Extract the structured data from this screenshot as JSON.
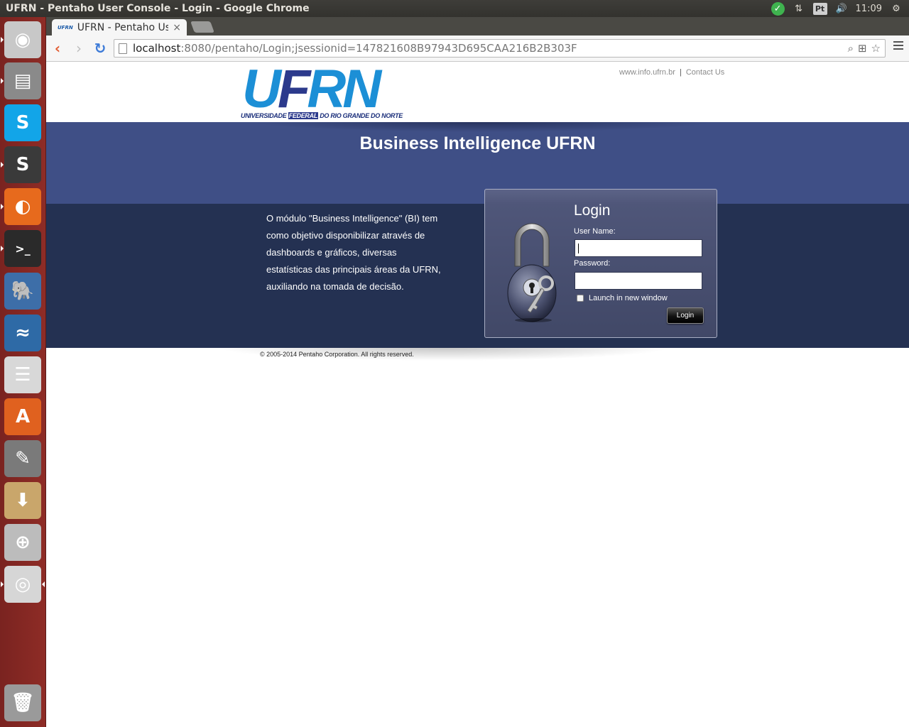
{
  "window": {
    "title": "UFRN - Pentaho User Console - Login - Google Chrome"
  },
  "tray": {
    "keyboard_layout": "Pt",
    "time": "11:09"
  },
  "launcher": {
    "items": [
      {
        "name": "ubuntu-dash",
        "glyph": "◉",
        "color": "#c8c8c8"
      },
      {
        "name": "files",
        "glyph": "▤",
        "color": "#8a8a8a"
      },
      {
        "name": "skype",
        "glyph": "S",
        "color": "#12a5e8"
      },
      {
        "name": "sublime-text",
        "glyph": "S",
        "color": "#3a3a3a"
      },
      {
        "name": "firefox",
        "glyph": "◐",
        "color": "#e76a1d"
      },
      {
        "name": "terminal",
        "glyph": ">_",
        "color": "#2a2a2a"
      },
      {
        "name": "pgadmin",
        "glyph": "🐘",
        "color": "#3d6ea8"
      },
      {
        "name": "mysql-workbench",
        "glyph": "≈",
        "color": "#2e6aa6"
      },
      {
        "name": "database",
        "glyph": "☰",
        "color": "#d8d8d8"
      },
      {
        "name": "software-center",
        "glyph": "A",
        "color": "#e0611f"
      },
      {
        "name": "system-settings",
        "glyph": "✎",
        "color": "#7a7a7a"
      },
      {
        "name": "archive-manager",
        "glyph": "⬇",
        "color": "#c9a66b"
      },
      {
        "name": "screenshot-tool",
        "glyph": "⊕",
        "color": "#bcbcbc"
      },
      {
        "name": "chrome",
        "glyph": "◎",
        "color": "#d6d6d6"
      },
      {
        "name": "trash",
        "glyph": "🗑",
        "color": "#9a9a9a"
      }
    ]
  },
  "browser": {
    "tab": {
      "favicon_text": "UFRN",
      "title": "UFRN - Pentaho User Console - Login",
      "close": "×"
    },
    "url": {
      "host": "localhost",
      "rest": ":8080/pentaho/Login;jsessionid=147821608B97943D695CAA216B2B303F"
    },
    "nav": {
      "back": "‹",
      "forward": "›",
      "reload": "↻"
    }
  },
  "header": {
    "logo_letters": {
      "u": "U",
      "f": "F",
      "rn": "RN"
    },
    "logo_sub": {
      "left": "UNIVERSIDADE ",
      "mid": "FEDERAL",
      "right": " DO RIO GRANDE DO NORTE"
    },
    "link_site": "www.info.ufrn.br",
    "link_separator": "|",
    "link_contact": "Contact Us"
  },
  "banner": {
    "title": "Business Intelligence UFRN"
  },
  "intro": {
    "text": "O módulo \"Business Intelligence\" (BI) tem como objetivo disponibilizar através de dashboards e gráficos, diversas estatísticas das principais áreas da UFRN, auxiliando na tomada de decisão."
  },
  "login": {
    "title": "Login",
    "username_label": "User Name:",
    "username_value": "",
    "password_label": "Password:",
    "password_value": "",
    "launch_label": "Launch in new window",
    "launch_checked": false,
    "button_label": "Login"
  },
  "footer": {
    "copyright": "© 2005-2014 Pentaho Corporation. All rights reserved."
  }
}
